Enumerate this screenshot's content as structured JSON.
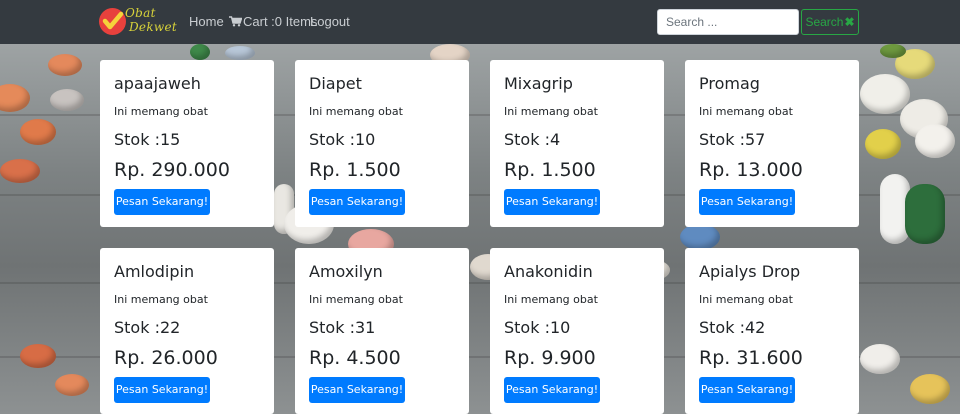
{
  "navbar": {
    "brand_line1": "Obat",
    "brand_line2": "Dekwet",
    "links": {
      "home": "Home",
      "cart": "Cart :0 Items",
      "logout": "Logout"
    },
    "search": {
      "placeholder": "Search ...",
      "button_label": "Search"
    },
    "colors": {
      "background": "#343a40",
      "link": "#c9cdd1",
      "search_button": "#28a745",
      "brand_check": "#e8413d",
      "brand_text": "#d8d33a"
    }
  },
  "products": [
    {
      "name": "apaajaweh",
      "description": "Ini memang obat",
      "stock": "Stok :15",
      "price": "Rp. 290.000",
      "button": "Pesan Sekarang!"
    },
    {
      "name": "Diapet",
      "description": "Ini memang obat",
      "stock": "Stok :10",
      "price": "Rp. 1.500",
      "button": "Pesan Sekarang!"
    },
    {
      "name": "Mixagrip",
      "description": "Ini memang obat",
      "stock": "Stok :4",
      "price": "Rp. 1.500",
      "button": "Pesan Sekarang!"
    },
    {
      "name": "Promag",
      "description": "Ini memang obat",
      "stock": "Stok :57",
      "price": "Rp. 13.000",
      "button": "Pesan Sekarang!"
    },
    {
      "name": "Amlodipin",
      "description": "Ini memang obat",
      "stock": "Stok :22",
      "price": "Rp. 26.000",
      "button": "Pesan Sekarang!"
    },
    {
      "name": "Amoxilyn",
      "description": "Ini memang obat",
      "stock": "Stok :31",
      "price": "Rp. 4.500",
      "button": "Pesan Sekarang!"
    },
    {
      "name": "Anakonidin",
      "description": "Ini memang obat",
      "stock": "Stok :10",
      "price": "Rp. 9.900",
      "button": "Pesan Sekarang!"
    },
    {
      "name": "Apialys Drop",
      "description": "Ini memang obat",
      "stock": "Stok :42",
      "price": "Rp. 31.600",
      "button": "Pesan Sekarang!"
    }
  ],
  "accent": {
    "order_button": "#007bff"
  }
}
